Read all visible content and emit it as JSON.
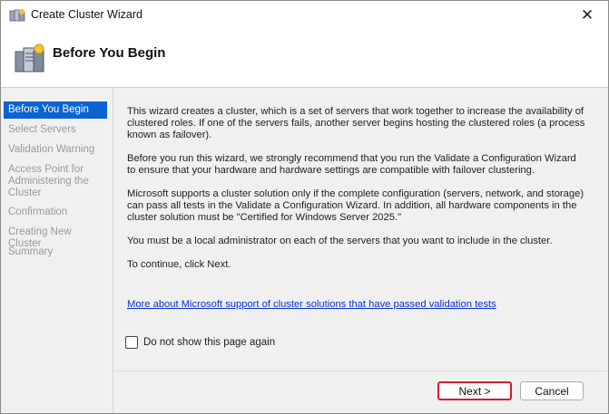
{
  "window": {
    "title": "Create Cluster Wizard",
    "close_glyph": "✕"
  },
  "header": {
    "title": "Before You Begin"
  },
  "sidebar": {
    "items": [
      {
        "label": "Before You Begin",
        "active": true
      },
      {
        "label": "Select Servers",
        "active": false
      },
      {
        "label": "Validation Warning",
        "active": false
      },
      {
        "label": "Access Point for Administering the Cluster",
        "active": false
      },
      {
        "label": "Confirmation",
        "active": false
      },
      {
        "label": "Creating New Cluster",
        "active": false
      },
      {
        "label": "Summary",
        "active": false
      }
    ]
  },
  "content": {
    "paragraphs": [
      "This wizard creates a cluster, which is a set of servers that work together to increase the availability of clustered roles. If one of the servers fails, another server begins hosting the clustered roles (a process known as failover).",
      "Before you run this wizard, we strongly recommend that you run the Validate a Configuration Wizard to ensure that your hardware and hardware settings are compatible with failover clustering.",
      "Microsoft supports a cluster solution only if the complete configuration (servers, network, and storage) can pass all tests in the Validate a Configuration Wizard. In addition, all hardware components in the cluster solution must be \"Certified for Windows Server 2025.\"",
      "You must be a local administrator on each of the servers that you want to include in the cluster.",
      "To continue, click Next."
    ],
    "link": "More about Microsoft support of cluster solutions that have passed validation tests",
    "checkbox_label": "Do not show this page again",
    "checkbox_checked": false
  },
  "footer": {
    "next_label": "Next >",
    "cancel_label": "Cancel"
  },
  "colors": {
    "accent": "#0a64d0",
    "link": "#0b2fd0",
    "highlight": "#d21f26"
  }
}
